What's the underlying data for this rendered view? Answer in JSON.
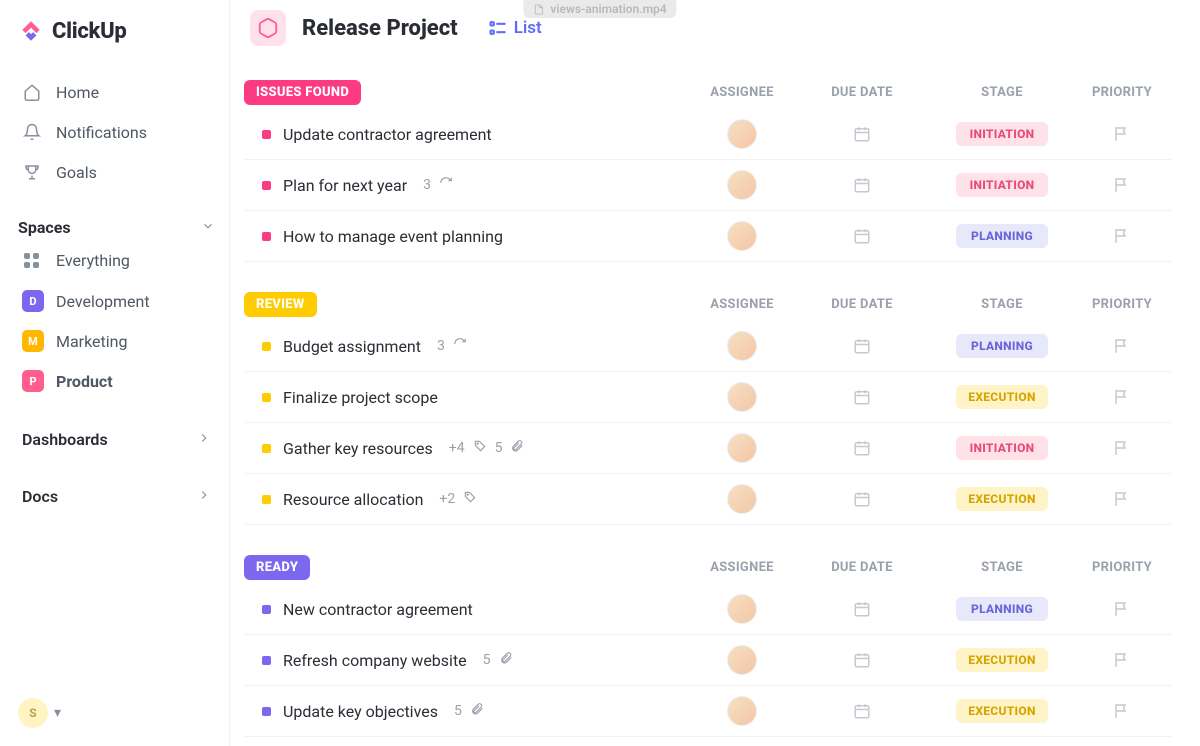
{
  "app": {
    "brand": "ClickUp",
    "file_tab": "views-animation.mp4"
  },
  "sidebar": {
    "nav": [
      {
        "label": "Home"
      },
      {
        "label": "Notifications"
      },
      {
        "label": "Goals"
      }
    ],
    "spaces_header": "Spaces",
    "everything": "Everything",
    "spaces": [
      {
        "letter": "D",
        "label": "Development",
        "color": "#7b68ee"
      },
      {
        "letter": "M",
        "label": "Marketing",
        "color": "#ffb700"
      },
      {
        "letter": "P",
        "label": "Product",
        "color": "#ff5e8e",
        "active": true
      }
    ],
    "dashboards": "Dashboards",
    "docs": "Docs",
    "user_initial": "S"
  },
  "header": {
    "project_title": "Release Project",
    "view_label": "List"
  },
  "columns": {
    "assignee": "ASSIGNEE",
    "due_date": "DUE DATE",
    "stage": "STAGE",
    "priority": "PRIORITY"
  },
  "stage_styles": {
    "INITIATION": {
      "bg": "#ffe1ea",
      "fg": "#e84b77"
    },
    "PLANNING": {
      "bg": "#e8e8fb",
      "fg": "#6a65d8"
    },
    "EXECUTION": {
      "bg": "#fff3c8",
      "fg": "#d6a500"
    }
  },
  "groups": [
    {
      "name": "ISSUES FOUND",
      "color": "#fd3b82",
      "dot": "#fd3b82",
      "tasks": [
        {
          "name": "Update contractor agreement",
          "stage": "INITIATION"
        },
        {
          "name": "Plan for next year",
          "subtasks": "3",
          "recurring": true,
          "stage": "INITIATION"
        },
        {
          "name": "How to manage event planning",
          "stage": "PLANNING"
        }
      ]
    },
    {
      "name": "REVIEW",
      "color": "#ffcc00",
      "dot": "#ffcc00",
      "tasks": [
        {
          "name": "Budget assignment",
          "subtasks": "3",
          "recurring": true,
          "stage": "PLANNING"
        },
        {
          "name": "Finalize project scope",
          "stage": "EXECUTION"
        },
        {
          "name": "Gather key resources",
          "tags": "+4",
          "attachments": "5",
          "stage": "INITIATION"
        },
        {
          "name": "Resource allocation",
          "tags": "+2",
          "stage": "EXECUTION"
        }
      ]
    },
    {
      "name": "READY",
      "color": "#7b68ee",
      "dot": "#7b68ee",
      "tasks": [
        {
          "name": "New contractor agreement",
          "stage": "PLANNING"
        },
        {
          "name": "Refresh company website",
          "attachments": "5",
          "stage": "EXECUTION"
        },
        {
          "name": "Update key objectives",
          "attachments": "5",
          "stage": "EXECUTION"
        }
      ]
    }
  ]
}
